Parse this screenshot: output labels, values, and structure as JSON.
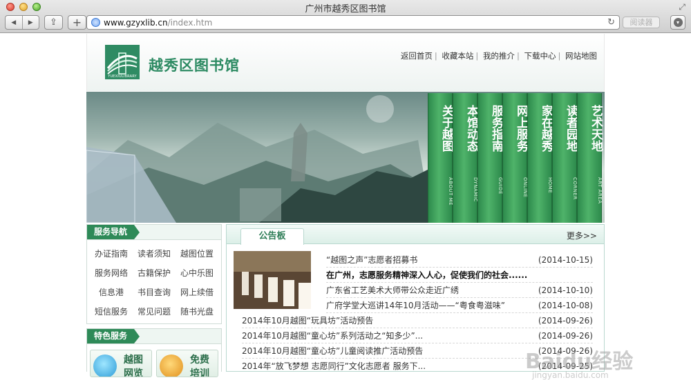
{
  "window": {
    "title": "广州市越秀区图书馆"
  },
  "toolbar": {
    "url_host": "www.gzyxlib.cn",
    "url_path": "/index.htm",
    "reader_label": "阅读器"
  },
  "header": {
    "logo_caption": "YUEXIULIBRARY",
    "logo_text": "越秀区图书馆",
    "links": [
      "返回首页",
      "收藏本站",
      "我的推介",
      "下载中心",
      "网站地图"
    ]
  },
  "banner": {
    "menu": [
      {
        "cn": "关于越图",
        "en": "ABOUT ME"
      },
      {
        "cn": "本馆动态",
        "en": "DYNAMIC"
      },
      {
        "cn": "服务指南",
        "en": "GUIDE"
      },
      {
        "cn": "网上服务",
        "en": "ONLINE"
      },
      {
        "cn": "家在越秀",
        "en": "HOME"
      },
      {
        "cn": "读者园地",
        "en": "CORNER"
      },
      {
        "cn": "艺术天地",
        "en": "ART AREA"
      }
    ]
  },
  "sidebar": {
    "nav_title": "服务导航",
    "nav_items": [
      "办证指南",
      "读者须知",
      "越图位置",
      "服务网络",
      "古籍保护",
      "心中乐图",
      "信息港",
      "书目查询",
      "网上续借",
      "短信服务",
      "常见问题",
      "随书光盘"
    ],
    "feature_title": "特色服务",
    "features": [
      "越图网览",
      "免费培训"
    ]
  },
  "notice": {
    "tab_label": "公告板",
    "more_label": "更多>>",
    "items": [
      {
        "title": "“越图之声”志愿者招募书",
        "date": "(2014-10-15)"
      },
      {
        "title": "在广州，志愿服务精神深入人心，促使我们的社会......",
        "date": ""
      },
      {
        "title": "广东省工艺美术大师带公众走近广绣",
        "date": "(2014-10-10)"
      },
      {
        "title": "广府学堂大巡讲14年10月活动——“粤食粤滋味”",
        "date": "(2014-10-08)"
      },
      {
        "title": "2014年10月越图“玩具坊”活动预告",
        "date": "(2014-09-26)"
      },
      {
        "title": "2014年10月越图“童心坊”系列活动之“知多少”...",
        "date": "(2014-09-26)"
      },
      {
        "title": "2014年10月越图“童心坊”儿童阅读推广活动预告",
        "date": "(2014-09-26)"
      },
      {
        "title": "2014年“放飞梦想 志愿同行”文化志愿者 服务下...",
        "date": "(2014-09-25)"
      }
    ]
  },
  "watermark": {
    "brand": "Baidu经验",
    "url": "jingyan.baidu.com"
  }
}
